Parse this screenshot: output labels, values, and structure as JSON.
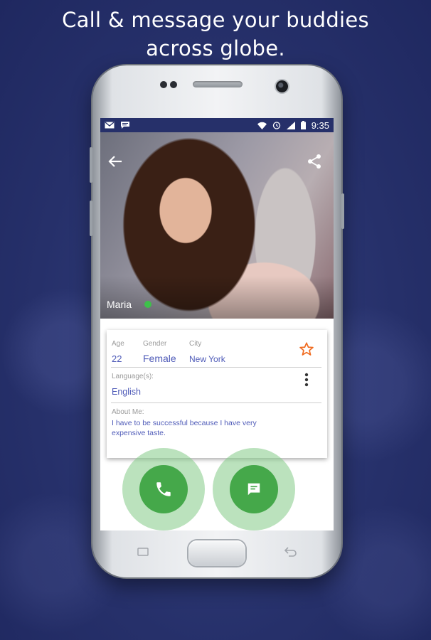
{
  "promo": {
    "headline": "Call & message  your buddies\nacross globe."
  },
  "status_bar": {
    "time": "9:35",
    "left_icons": [
      "mail-icon",
      "chat-icon"
    ],
    "right_icons": [
      "wifi-icon",
      "alarm-icon",
      "signal-icon",
      "battery-icon"
    ]
  },
  "profile": {
    "name": "Maria",
    "online": true,
    "status_color": "#3ec14a"
  },
  "details": {
    "age_label": "Age",
    "age_value": "22",
    "gender_label": "Gender",
    "gender_value": "Female",
    "city_label": "City",
    "city_value": "New York",
    "language_label": "Language(s):",
    "language_value": "English",
    "about_label": "About Me:",
    "about_value": "I have to be successful because I have very expensive taste."
  },
  "actions": {
    "call_icon": "phone-icon",
    "message_icon": "message-icon",
    "accent_color": "#45a84a"
  },
  "colors": {
    "background": "#26306a",
    "value_text": "#4f5bb8",
    "favorite_star": "#f06a1e"
  }
}
